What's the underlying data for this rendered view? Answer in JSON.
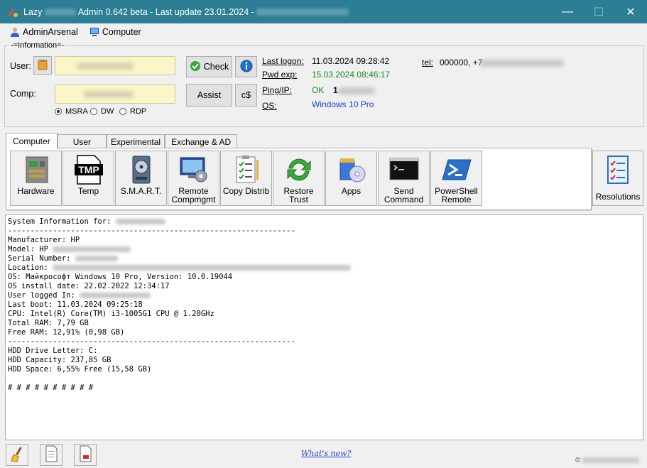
{
  "window": {
    "title_prefix": "Lazy",
    "title_mid": "Admin 0.642 beta - Last update 23.01.2024 -",
    "minimize": "—",
    "maximize": "☐",
    "close": "✕"
  },
  "menubar": {
    "items": [
      {
        "label": "AdminArsenal",
        "icon": "user-icon"
      },
      {
        "label": "Computer",
        "icon": "computer-icon"
      }
    ]
  },
  "info": {
    "legend": "-=Information=-",
    "user_label": "User:",
    "comp_label": "Comp:",
    "check_button": "Check",
    "assist_button": "Assist",
    "cs_button": "c$",
    "radios": [
      {
        "label": "MSRA",
        "checked": true
      },
      {
        "label": "DW",
        "checked": false
      },
      {
        "label": "RDP",
        "checked": false
      }
    ],
    "last_logon_label": "Last logon:",
    "last_logon_value": "11.03.2024 09:28:42",
    "pwd_exp_label": "Pwd exp:",
    "pwd_exp_value": "15.03.2024 08:46:17",
    "ping_label": "Ping/IP:",
    "ping_status": "OK",
    "ping_ip_prefix": "1",
    "os_label": "OS:",
    "os_value": "Windows 10 Pro",
    "tel_label": "tel:",
    "tel_value": "000000, +7"
  },
  "tabs": [
    {
      "label": "Computer",
      "active": true
    },
    {
      "label": "User",
      "active": false
    },
    {
      "label": "Experimental",
      "active": false
    },
    {
      "label": "Exchange & AD",
      "active": false
    }
  ],
  "tools": [
    {
      "label": "Hardware",
      "icon": "hardware-icon"
    },
    {
      "label": "Temp",
      "icon": "tmp-icon"
    },
    {
      "label": "S.M.A.R.T.",
      "icon": "hdd-icon"
    },
    {
      "label": "Remote\nCompmgmt",
      "icon": "compmgmt-icon"
    },
    {
      "label": "Copy Distrib",
      "icon": "checklist-icon"
    },
    {
      "label": "Restore\nTrust",
      "icon": "restore-icon"
    },
    {
      "label": "Apps",
      "icon": "apps-icon"
    },
    {
      "label": "Send\nCommand",
      "icon": "cmd-icon"
    },
    {
      "label": "PowerShell\nRemote",
      "icon": "powershell-icon"
    }
  ],
  "resolutions_button": "Resolutions",
  "tmp_icon_text": "TMP",
  "output": {
    "lines": [
      "System Information for:",
      "----------------------------------------------------------------",
      "Manufacturer: HP",
      "Model: HP",
      "Serial Number:",
      "Location:",
      "OS: Майкрософт Windows 10 Pro, Version: 10.0.19044",
      "OS install date: 22.02.2022 12:34:17",
      "User logged In:",
      "Last boot: 11.03.2024 09:25:18",
      "CPU: Intel(R) Core(TM) i3-1005G1 CPU @ 1.20GHz",
      "Total RAM: 7,79 GB",
      "Free RAM: 12,91% (0,98 GB)",
      "----------------------------------------------------------------",
      "HDD Drive Letter: C:",
      "HDD Capacity: 237,85 GB",
      "HDD Space: 6,55% Free (15,58 GB)",
      "",
      "# # # # # # # # # #"
    ]
  },
  "footer": {
    "whats_new": "What's new?",
    "copyright": "©"
  }
}
